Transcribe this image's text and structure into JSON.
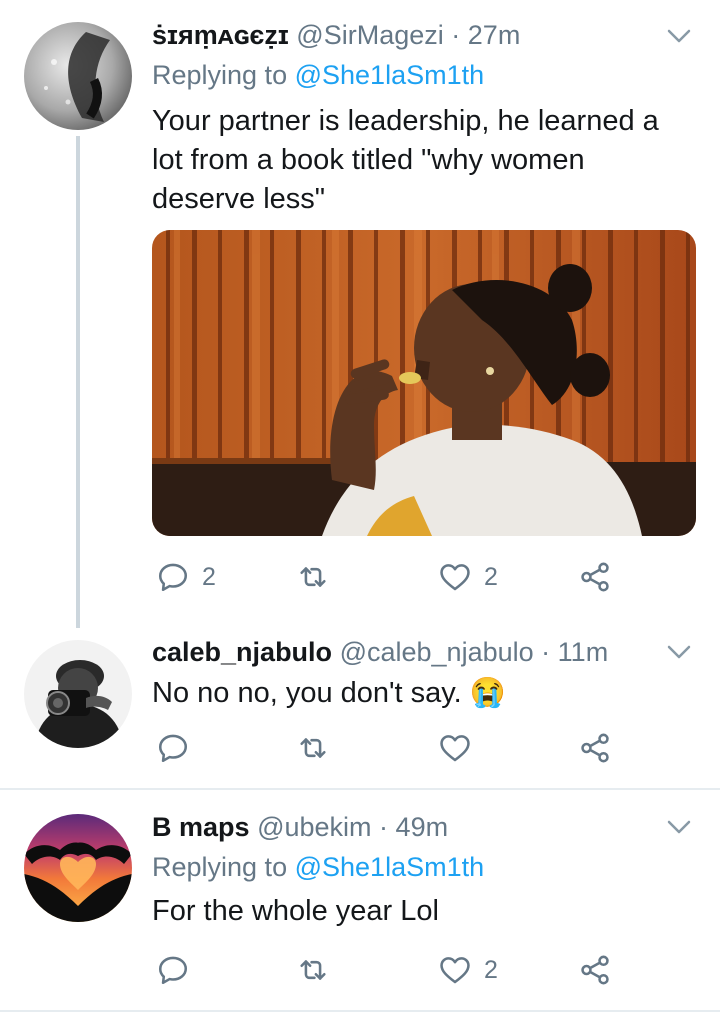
{
  "tweets": [
    {
      "display_name": "ṡɪяṃᴀɢєẓɪ",
      "handle": "@SirMagezi",
      "time": "27m",
      "replying_label": "Replying to",
      "replying_to": "@She1laSm1th",
      "text": "Your partner is leadership, he learned a lot from a book titled \"why women deserve less\"",
      "reply_count": "2",
      "retweet_count": "",
      "like_count": "2"
    },
    {
      "display_name": "caleb_njabulo",
      "handle": "@caleb_njabulo",
      "time": "11m",
      "text": "No no no, you don't say.",
      "emoji": "😭",
      "reply_count": "",
      "retweet_count": "",
      "like_count": ""
    },
    {
      "display_name": "B maps",
      "handle": "@ubekim",
      "time": "49m",
      "replying_label": "Replying to",
      "replying_to": "@She1laSm1th",
      "text": "For the whole year Lol",
      "reply_count": "",
      "retweet_count": "",
      "like_count": "2"
    }
  ],
  "colors": {
    "text": "#14171a",
    "secondary": "#657786",
    "link": "#1da1f2",
    "divider": "#e6ecf0",
    "thread_line": "#ccd6dd"
  },
  "icons": [
    "reply-icon",
    "retweet-icon",
    "like-icon",
    "share-icon",
    "chevron-down-icon"
  ]
}
